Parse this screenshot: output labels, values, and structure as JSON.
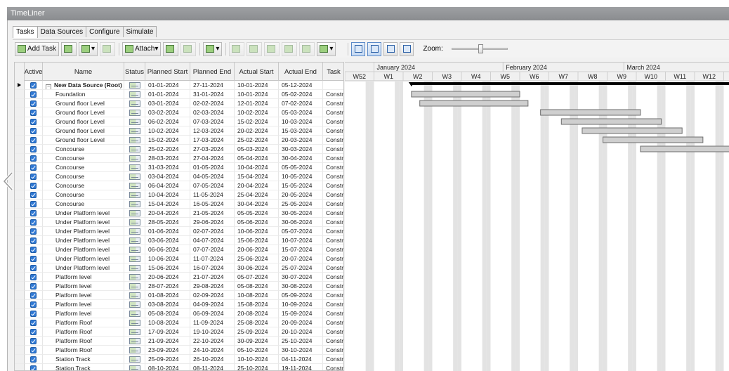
{
  "window": {
    "title": "TimeLiner"
  },
  "tabs": [
    {
      "label": "Tasks",
      "active": true
    },
    {
      "label": "Data Sources",
      "active": false
    },
    {
      "label": "Configure",
      "active": false
    },
    {
      "label": "Simulate",
      "active": false
    }
  ],
  "toolbar": {
    "add_task_label": "Add Task",
    "attach_label": "Attach",
    "zoom_label": "Zoom:",
    "zoom_level": 0.5
  },
  "columns": [
    "Active",
    "Name",
    "Status",
    "Planned Start",
    "Planned End",
    "Actual Start",
    "Actual End",
    "Task"
  ],
  "rows": [
    {
      "name": "New Data Source (Root)",
      "ps": "01-01-2024",
      "pe": "27-11-2024",
      "as": "10-01-2024",
      "ae": "05-12-2024",
      "task": ""
    },
    {
      "name": "Foundation",
      "ps": "01-01-2024",
      "pe": "31-01-2024",
      "as": "10-01-2024",
      "ae": "05-02-2024",
      "task": "Constr"
    },
    {
      "name": "Ground floor Level",
      "ps": "03-01-2024",
      "pe": "02-02-2024",
      "as": "12-01-2024",
      "ae": "07-02-2024",
      "task": "Constr"
    },
    {
      "name": "Ground floor Level",
      "ps": "03-02-2024",
      "pe": "02-03-2024",
      "as": "10-02-2024",
      "ae": "05-03-2024",
      "task": "Constr"
    },
    {
      "name": "Ground floor Level",
      "ps": "06-02-2024",
      "pe": "07-03-2024",
      "as": "15-02-2024",
      "ae": "10-03-2024",
      "task": "Constr"
    },
    {
      "name": "Ground floor Level",
      "ps": "10-02-2024",
      "pe": "12-03-2024",
      "as": "20-02-2024",
      "ae": "15-03-2024",
      "task": "Constr"
    },
    {
      "name": "Ground floor Level",
      "ps": "15-02-2024",
      "pe": "17-03-2024",
      "as": "25-02-2024",
      "ae": "20-03-2024",
      "task": "Constr"
    },
    {
      "name": "Concourse",
      "ps": "25-02-2024",
      "pe": "27-03-2024",
      "as": "05-03-2024",
      "ae": "30-03-2024",
      "task": "Constr"
    },
    {
      "name": "Concourse",
      "ps": "28-03-2024",
      "pe": "27-04-2024",
      "as": "05-04-2024",
      "ae": "30-04-2024",
      "task": "Constr"
    },
    {
      "name": "Concourse",
      "ps": "31-03-2024",
      "pe": "01-05-2024",
      "as": "10-04-2024",
      "ae": "05-05-2024",
      "task": "Constr"
    },
    {
      "name": "Concourse",
      "ps": "03-04-2024",
      "pe": "04-05-2024",
      "as": "15-04-2024",
      "ae": "10-05-2024",
      "task": "Constr"
    },
    {
      "name": "Concourse",
      "ps": "06-04-2024",
      "pe": "07-05-2024",
      "as": "20-04-2024",
      "ae": "15-05-2024",
      "task": "Constr"
    },
    {
      "name": "Concourse",
      "ps": "10-04-2024",
      "pe": "11-05-2024",
      "as": "25-04-2024",
      "ae": "20-05-2024",
      "task": "Constr"
    },
    {
      "name": "Concourse",
      "ps": "15-04-2024",
      "pe": "16-05-2024",
      "as": "30-04-2024",
      "ae": "25-05-2024",
      "task": "Constr"
    },
    {
      "name": "Under Platform level",
      "ps": "20-04-2024",
      "pe": "21-05-2024",
      "as": "05-05-2024",
      "ae": "30-05-2024",
      "task": "Constr"
    },
    {
      "name": "Under Platform level",
      "ps": "28-05-2024",
      "pe": "29-06-2024",
      "as": "05-06-2024",
      "ae": "30-06-2024",
      "task": "Constr"
    },
    {
      "name": "Under Platform level",
      "ps": "01-06-2024",
      "pe": "02-07-2024",
      "as": "10-06-2024",
      "ae": "05-07-2024",
      "task": "Constr"
    },
    {
      "name": "Under Platform level",
      "ps": "03-06-2024",
      "pe": "04-07-2024",
      "as": "15-06-2024",
      "ae": "10-07-2024",
      "task": "Constr"
    },
    {
      "name": "Under Platform level",
      "ps": "06-06-2024",
      "pe": "07-07-2024",
      "as": "20-06-2024",
      "ae": "15-07-2024",
      "task": "Constr"
    },
    {
      "name": "Under Platform level",
      "ps": "10-06-2024",
      "pe": "11-07-2024",
      "as": "25-06-2024",
      "ae": "20-07-2024",
      "task": "Constr"
    },
    {
      "name": "Under Platform level",
      "ps": "15-06-2024",
      "pe": "16-07-2024",
      "as": "30-06-2024",
      "ae": "25-07-2024",
      "task": "Constr"
    },
    {
      "name": "Platform level",
      "ps": "20-06-2024",
      "pe": "21-07-2024",
      "as": "05-07-2024",
      "ae": "30-07-2024",
      "task": "Constr"
    },
    {
      "name": "Platform level",
      "ps": "28-07-2024",
      "pe": "29-08-2024",
      "as": "05-08-2024",
      "ae": "30-08-2024",
      "task": "Constr"
    },
    {
      "name": "Platform level",
      "ps": "01-08-2024",
      "pe": "02-09-2024",
      "as": "10-08-2024",
      "ae": "05-09-2024",
      "task": "Constr"
    },
    {
      "name": "Platform level",
      "ps": "03-08-2024",
      "pe": "04-09-2024",
      "as": "15-08-2024",
      "ae": "10-09-2024",
      "task": "Constr"
    },
    {
      "name": "Platform level",
      "ps": "05-08-2024",
      "pe": "06-09-2024",
      "as": "20-08-2024",
      "ae": "15-09-2024",
      "task": "Constr"
    },
    {
      "name": "Platform Roof",
      "ps": "10-08-2024",
      "pe": "11-09-2024",
      "as": "25-08-2024",
      "ae": "20-09-2024",
      "task": "Constr"
    },
    {
      "name": "Platform Roof",
      "ps": "17-09-2024",
      "pe": "19-10-2024",
      "as": "25-09-2024",
      "ae": "20-10-2024",
      "task": "Constr"
    },
    {
      "name": "Platform Roof",
      "ps": "21-09-2024",
      "pe": "22-10-2024",
      "as": "30-09-2024",
      "ae": "25-10-2024",
      "task": "Constr"
    },
    {
      "name": "Platform Roof",
      "ps": "23-09-2024",
      "pe": "24-10-2024",
      "as": "05-10-2024",
      "ae": "30-10-2024",
      "task": "Constr"
    },
    {
      "name": "Station Track",
      "ps": "25-09-2024",
      "pe": "26-10-2024",
      "as": "10-10-2024",
      "ae": "04-11-2024",
      "task": "Constr"
    },
    {
      "name": "Station Track",
      "ps": "08-10-2024",
      "pe": "08-11-2024",
      "as": "25-10-2024",
      "ae": "19-11-2024",
      "task": "Constr"
    }
  ],
  "gantt": {
    "months": [
      "January 2024",
      "February 2024",
      "March 2024"
    ],
    "weeks": [
      "W52",
      "W1",
      "W2",
      "W3",
      "W4",
      "W5",
      "W6",
      "W7",
      "W8",
      "W9",
      "W10",
      "W11",
      "W12",
      "W"
    ],
    "first_week_start": "2023-12-25",
    "colors": {
      "bar_fill": "#cfcfcf",
      "bar_stroke": "#6e6e6e",
      "weekend": "#e3e3e3",
      "root_bar": "#000000"
    }
  }
}
